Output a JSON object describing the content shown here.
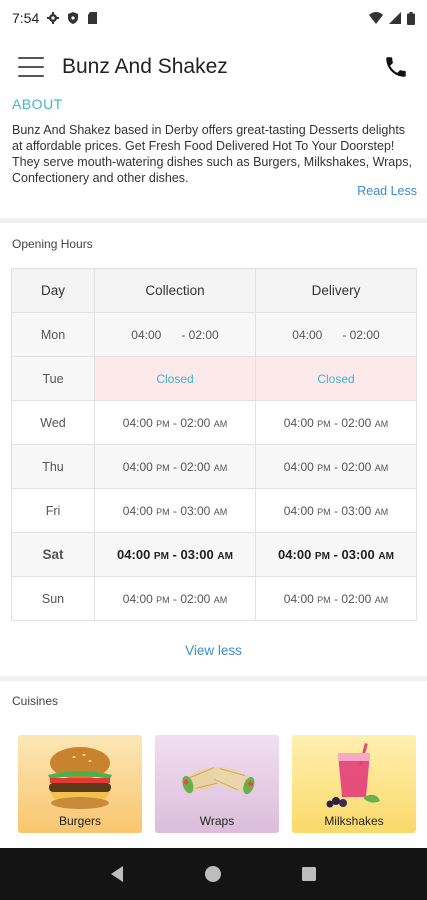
{
  "status_bar": {
    "time": "7:54"
  },
  "app_bar": {
    "title": "Bunz And Shakez"
  },
  "about": {
    "heading": "ABOUT",
    "text": "Bunz And Shakez based in Derby offers great-tasting Desserts delights at affordable prices. Get Fresh Food Delivered Hot To Your Doorstep! They serve mouth-watering dishes such as Burgers, Milkshakes, Wraps, Confectionery and other dishes.",
    "read_less": "Read Less"
  },
  "opening_hours": {
    "title": "Opening Hours",
    "headers": {
      "day": "Day",
      "collection": "Collection",
      "delivery": "Delivery"
    },
    "rows": [
      {
        "day": "Mon",
        "collection": {
          "open": "04:00",
          "open_ampm": "",
          "close": "- 02:00",
          "close_ampm": ""
        },
        "delivery": {
          "open": "04:00",
          "open_ampm": "",
          "close": "- 02:00",
          "close_ampm": ""
        }
      },
      {
        "day": "Tue",
        "closed_label": "Closed"
      },
      {
        "day": "Wed",
        "collection": {
          "open": "04:00",
          "open_ampm": "PM",
          "close": "- 02:00",
          "close_ampm": "AM"
        },
        "delivery": {
          "open": "04:00",
          "open_ampm": "PM",
          "close": "- 02:00",
          "close_ampm": "AM"
        }
      },
      {
        "day": "Thu",
        "collection": {
          "open": "04:00",
          "open_ampm": "PM",
          "close": "- 02:00",
          "close_ampm": "AM"
        },
        "delivery": {
          "open": "04:00",
          "open_ampm": "PM",
          "close": "- 02:00",
          "close_ampm": "AM"
        }
      },
      {
        "day": "Fri",
        "collection": {
          "open": "04:00",
          "open_ampm": "PM",
          "close": "- 03:00",
          "close_ampm": "AM"
        },
        "delivery": {
          "open": "04:00",
          "open_ampm": "PM",
          "close": "- 03:00",
          "close_ampm": "AM"
        }
      },
      {
        "day": "Sat",
        "collection": {
          "open": "04:00",
          "open_ampm": "PM",
          "close": "- 03:00",
          "close_ampm": "AM"
        },
        "delivery": {
          "open": "04:00",
          "open_ampm": "PM",
          "close": "- 03:00",
          "close_ampm": "AM"
        }
      },
      {
        "day": "Sun",
        "collection": {
          "open": "04:00",
          "open_ampm": "PM",
          "close": "- 02:00",
          "close_ampm": "AM"
        },
        "delivery": {
          "open": "04:00",
          "open_ampm": "PM",
          "close": "- 02:00",
          "close_ampm": "AM"
        }
      }
    ],
    "view_less": "View less"
  },
  "cuisines": {
    "title": "Cuisines",
    "items": [
      {
        "label": "Burgers",
        "icon": "burger-icon"
      },
      {
        "label": "Wraps",
        "icon": "wrap-icon"
      },
      {
        "label": "Milkshakes",
        "icon": "milkshake-icon"
      }
    ]
  },
  "colors": {
    "accent_teal": "#3fb6c8",
    "link_blue": "#3f8ccf",
    "closed_bg": "#fde9ea"
  }
}
